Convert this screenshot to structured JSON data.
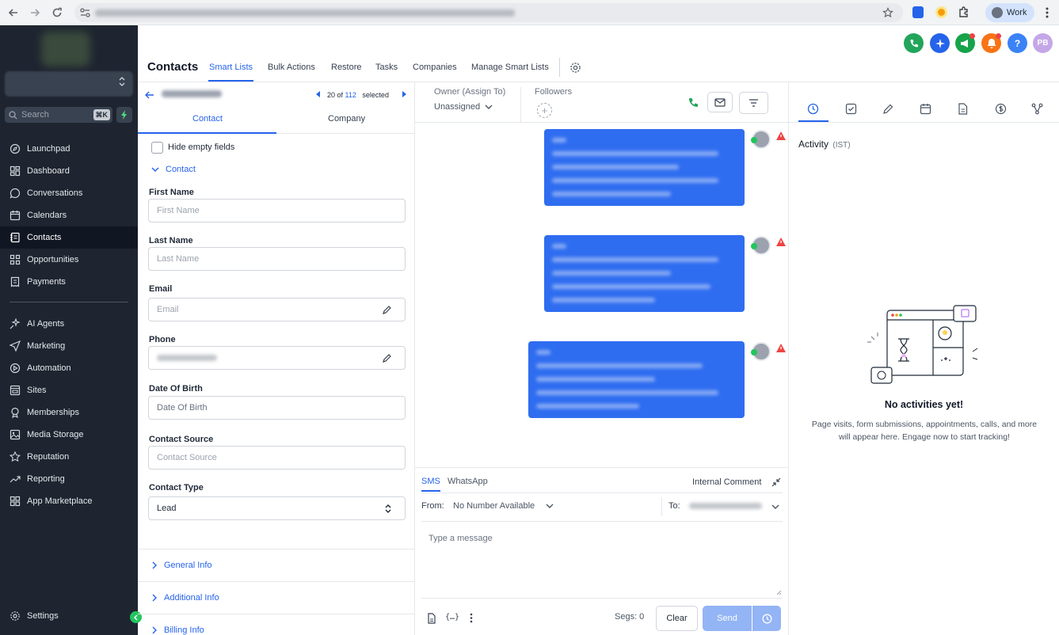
{
  "browser": {
    "profile_label": "Work"
  },
  "topbar": {
    "title": "Contacts",
    "tabs": [
      "Smart Lists",
      "Bulk Actions",
      "Restore",
      "Tasks",
      "Companies",
      "Manage Smart Lists"
    ],
    "avatar_initials": "PB",
    "help_symbol": "?",
    "colors": {
      "phone": "#22a55b",
      "ai": "#2563eb",
      "megaphone": "#16a34a",
      "bell": "#f97316",
      "help": "#3b82f6",
      "avatar": "#c4a7e7"
    }
  },
  "sidebar": {
    "search_placeholder": "Search",
    "search_shortcut": "⌘K",
    "items": [
      {
        "label": "Launchpad",
        "icon": "rocket-icon"
      },
      {
        "label": "Dashboard",
        "icon": "grid-icon"
      },
      {
        "label": "Conversations",
        "icon": "chat-icon"
      },
      {
        "label": "Calendars",
        "icon": "calendar-icon"
      },
      {
        "label": "Contacts",
        "icon": "contacts-icon",
        "active": true
      },
      {
        "label": "Opportunities",
        "icon": "funnel-icon"
      },
      {
        "label": "Payments",
        "icon": "receipt-icon"
      }
    ],
    "items2": [
      {
        "label": "AI Agents",
        "icon": "sparkle-icon"
      },
      {
        "label": "Marketing",
        "icon": "send-icon"
      },
      {
        "label": "Automation",
        "icon": "automation-icon"
      },
      {
        "label": "Sites",
        "icon": "sites-icon"
      },
      {
        "label": "Memberships",
        "icon": "membership-icon"
      },
      {
        "label": "Media Storage",
        "icon": "image-icon"
      },
      {
        "label": "Reputation",
        "icon": "star-icon"
      },
      {
        "label": "Reporting",
        "icon": "chart-icon"
      },
      {
        "label": "App Marketplace",
        "icon": "apps-icon"
      }
    ],
    "settings_label": "Settings",
    "accent": "#1e2530"
  },
  "contact_panel": {
    "nav": {
      "count_text": "20 of",
      "total": "112",
      "suffix": "selected"
    },
    "tabs": [
      "Contact",
      "Company"
    ],
    "hide_empty_label": "Hide empty fields",
    "section_contact": "Contact",
    "fields": {
      "first_name": {
        "label": "First Name",
        "placeholder": "First Name"
      },
      "last_name": {
        "label": "Last Name",
        "placeholder": "Last Name"
      },
      "email": {
        "label": "Email",
        "placeholder": "Email"
      },
      "phone": {
        "label": "Phone"
      },
      "dob": {
        "label": "Date Of Birth",
        "placeholder": "Date Of Birth"
      },
      "source": {
        "label": "Contact Source",
        "placeholder": "Contact Source"
      },
      "type": {
        "label": "Contact Type",
        "value": "Lead"
      }
    },
    "sections": [
      "General Info",
      "Additional Info",
      "Billing Info"
    ]
  },
  "conversation": {
    "owner_label": "Owner (Assign To)",
    "owner_value": "Unassigned",
    "followers_label": "Followers",
    "channels": [
      "SMS",
      "WhatsApp"
    ],
    "internal_comment": "Internal Comment",
    "from_label": "From:",
    "from_value": "No Number Available",
    "to_label": "To:",
    "message_placeholder": "Type a message",
    "segs_text": "Segs: 0",
    "clear_label": "Clear",
    "send_label": "Send",
    "bubble_color": "#2f6df0"
  },
  "activity": {
    "title": "Activity",
    "timezone": "(IST)",
    "empty_title": "No activities yet!",
    "empty_text": "Page visits, form submissions, appointments, calls, and more will appear here. Engage now to start tracking!"
  }
}
